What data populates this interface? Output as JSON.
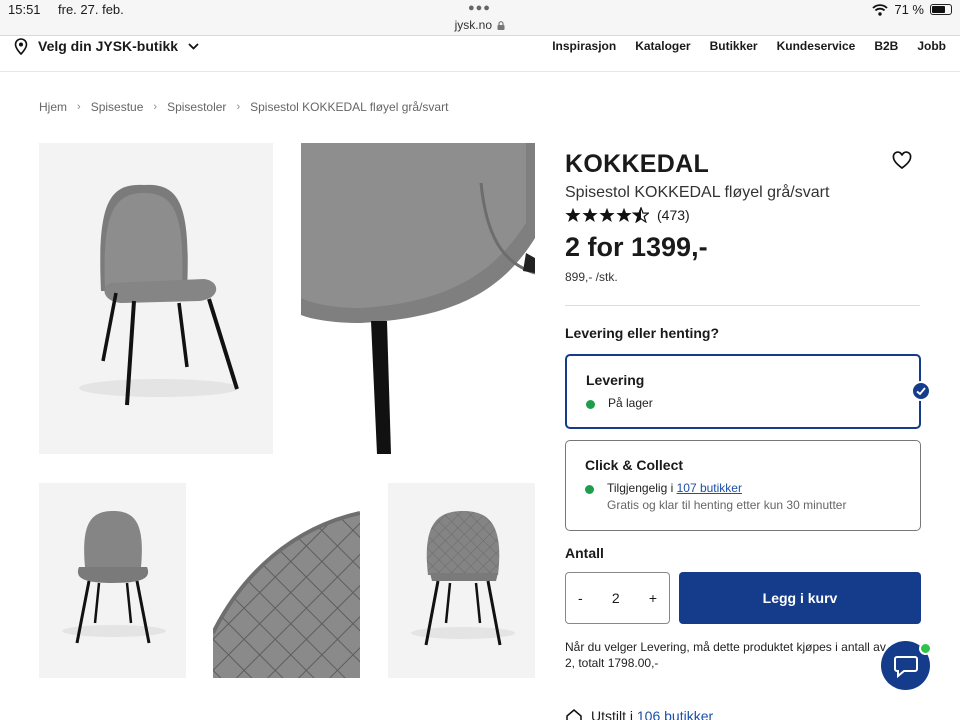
{
  "status_bar": {
    "time": "15:51",
    "date": "fre. 27. feb.",
    "url": "jysk.no",
    "battery": "71 %",
    "battery_level": 0.71
  },
  "header": {
    "store_label": "Velg din JYSK-butikk",
    "nav": [
      "Inspirasjon",
      "Kataloger",
      "Butikker",
      "Kundeservice",
      "B2B",
      "Jobb"
    ]
  },
  "breadcrumb": [
    "Hjem",
    "Spisestue",
    "Spisestoler",
    "Spisestol KOKKEDAL fløyel grå/svart"
  ],
  "product": {
    "title": "KOKKEDAL",
    "subtitle": "Spisestol KOKKEDAL fløyel grå/svart",
    "rating": 4.5,
    "rating_count": "(473)",
    "price": "2 for 1399,-",
    "unit_price": "899,- /stk."
  },
  "delivery": {
    "question": "Levering eller henting?",
    "options": [
      {
        "name": "Levering",
        "status": "På lager",
        "selected": true
      },
      {
        "name": "Click & Collect",
        "status_prefix": "Tilgjengelig i ",
        "status_link": "107 butikker",
        "detail": "Gratis og klar til henting etter kun 30 minutter"
      }
    ]
  },
  "quantity": {
    "label": "Antall",
    "value": "2",
    "minus": "-",
    "plus": "+"
  },
  "cart_button": "Legg i kurv",
  "note": "Når du velger Levering, må dette produktet kjøpes i antall av 2, totalt 1798.00,-",
  "stock": {
    "prefix": "Utstilt i ",
    "link": "106 butikker"
  },
  "colors": {
    "primary": "#143c8a",
    "in_stock": "#1e9e4a",
    "chat_badge": "#2fc24a"
  }
}
